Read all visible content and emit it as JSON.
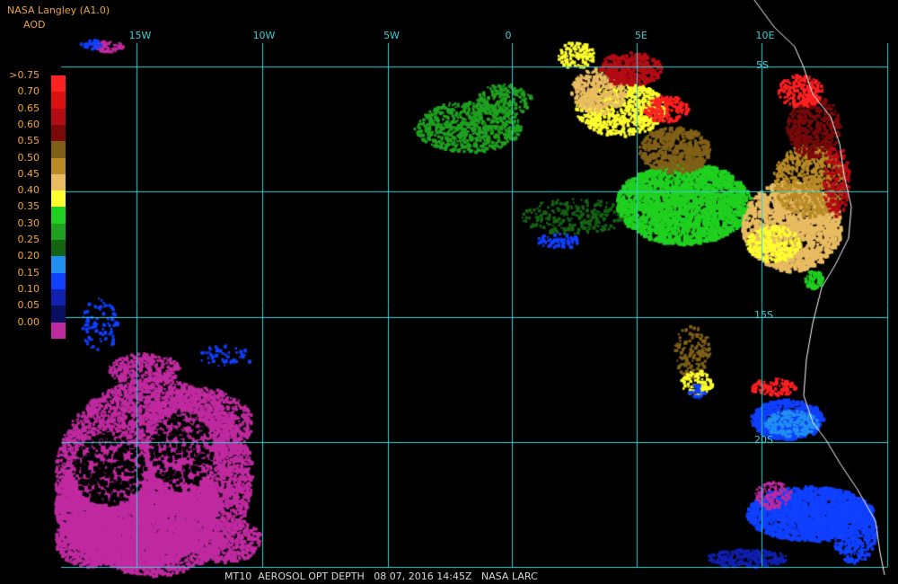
{
  "header": {
    "source": "NASA Langley (A1.0)",
    "product": "AOD"
  },
  "legend": {
    "labels": [
      ">0.75",
      "0.70",
      "0.65",
      "0.60",
      "0.55",
      "0.50",
      "0.45",
      "0.40",
      "0.35",
      "0.30",
      "0.25",
      "0.20",
      "0.15",
      "0.10",
      "0.05",
      "0.00"
    ],
    "colors": [
      "#ff2020",
      "#dd1010",
      "#b40c14",
      "#7a0a0a",
      "#806018",
      "#b98a26",
      "#e9bc62",
      "#ffff30",
      "#20d020",
      "#20a020",
      "#146414",
      "#2090f0",
      "#1040ff",
      "#1020b0",
      "#0a1060",
      "#c02aa0"
    ]
  },
  "grid": {
    "lon_labels": [
      "15W",
      "10W",
      "5W",
      "0",
      "5E",
      "10E"
    ],
    "lat_labels": [
      "5S",
      "15S",
      "20S"
    ]
  },
  "footer": {
    "text": "MT10  AEROSOL OPT DEPTH   08 07, 2016 14:45Z   NASA LARC"
  },
  "colors": {
    "background": "#000000",
    "gridline": "#39cfd6",
    "coastline": "#ffffff",
    "legend_text": "#f2a640"
  }
}
